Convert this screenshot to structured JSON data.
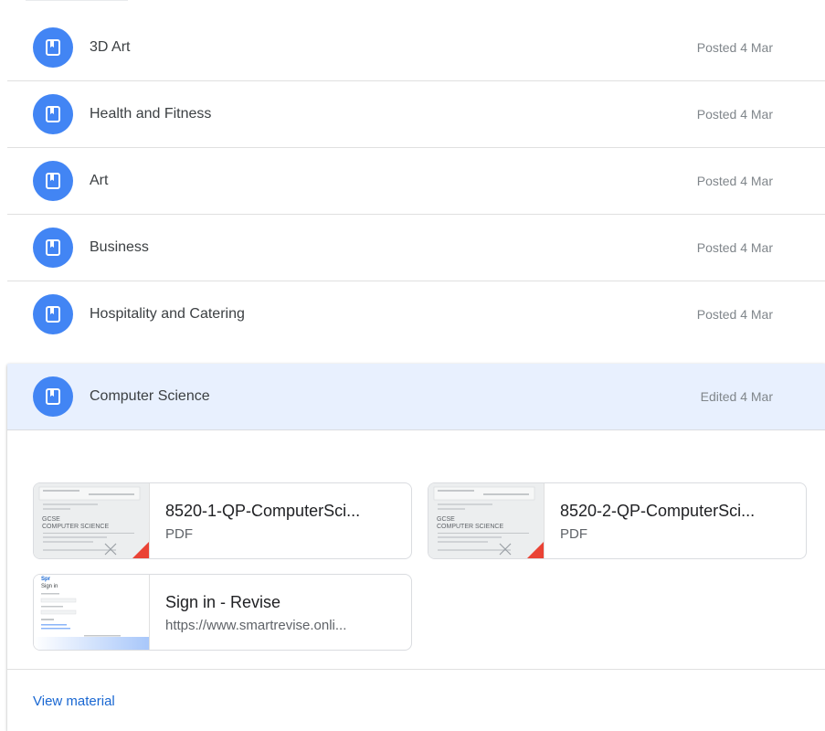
{
  "materials_list": [
    {
      "title": "3D Art",
      "date": "Posted 4 Mar"
    },
    {
      "title": "Health and Fitness",
      "date": "Posted 4 Mar"
    },
    {
      "title": "Art",
      "date": "Posted 4 Mar"
    },
    {
      "title": "Business",
      "date": "Posted 4 Mar"
    },
    {
      "title": "Hospitality and Catering",
      "date": "Posted 4 Mar"
    }
  ],
  "expanded_material": {
    "title": "Computer Science",
    "date": "Edited 4 Mar",
    "attachments": [
      {
        "title": "8520-1-QP-ComputerSci...",
        "subtitle": "PDF",
        "thumb_heading": "COMPUTER SCIENCE",
        "thumb_label": "GCSE"
      },
      {
        "title": "8520-2-QP-ComputerSci...",
        "subtitle": "PDF",
        "thumb_heading": "COMPUTER SCIENCE",
        "thumb_label": "GCSE"
      },
      {
        "title": "Sign in - Revise",
        "subtitle": "https://www.smartrevise.onli...",
        "thumb_heading": "Sign in",
        "thumb_label": "Spr"
      }
    ],
    "view_link": "View material"
  },
  "colors": {
    "accent_blue": "#4285f4",
    "link_blue": "#1967d2",
    "selected_bg": "#e8f0fe",
    "pdf_red": "#ea4335"
  },
  "icons": {
    "material_badge": "book-icon"
  }
}
